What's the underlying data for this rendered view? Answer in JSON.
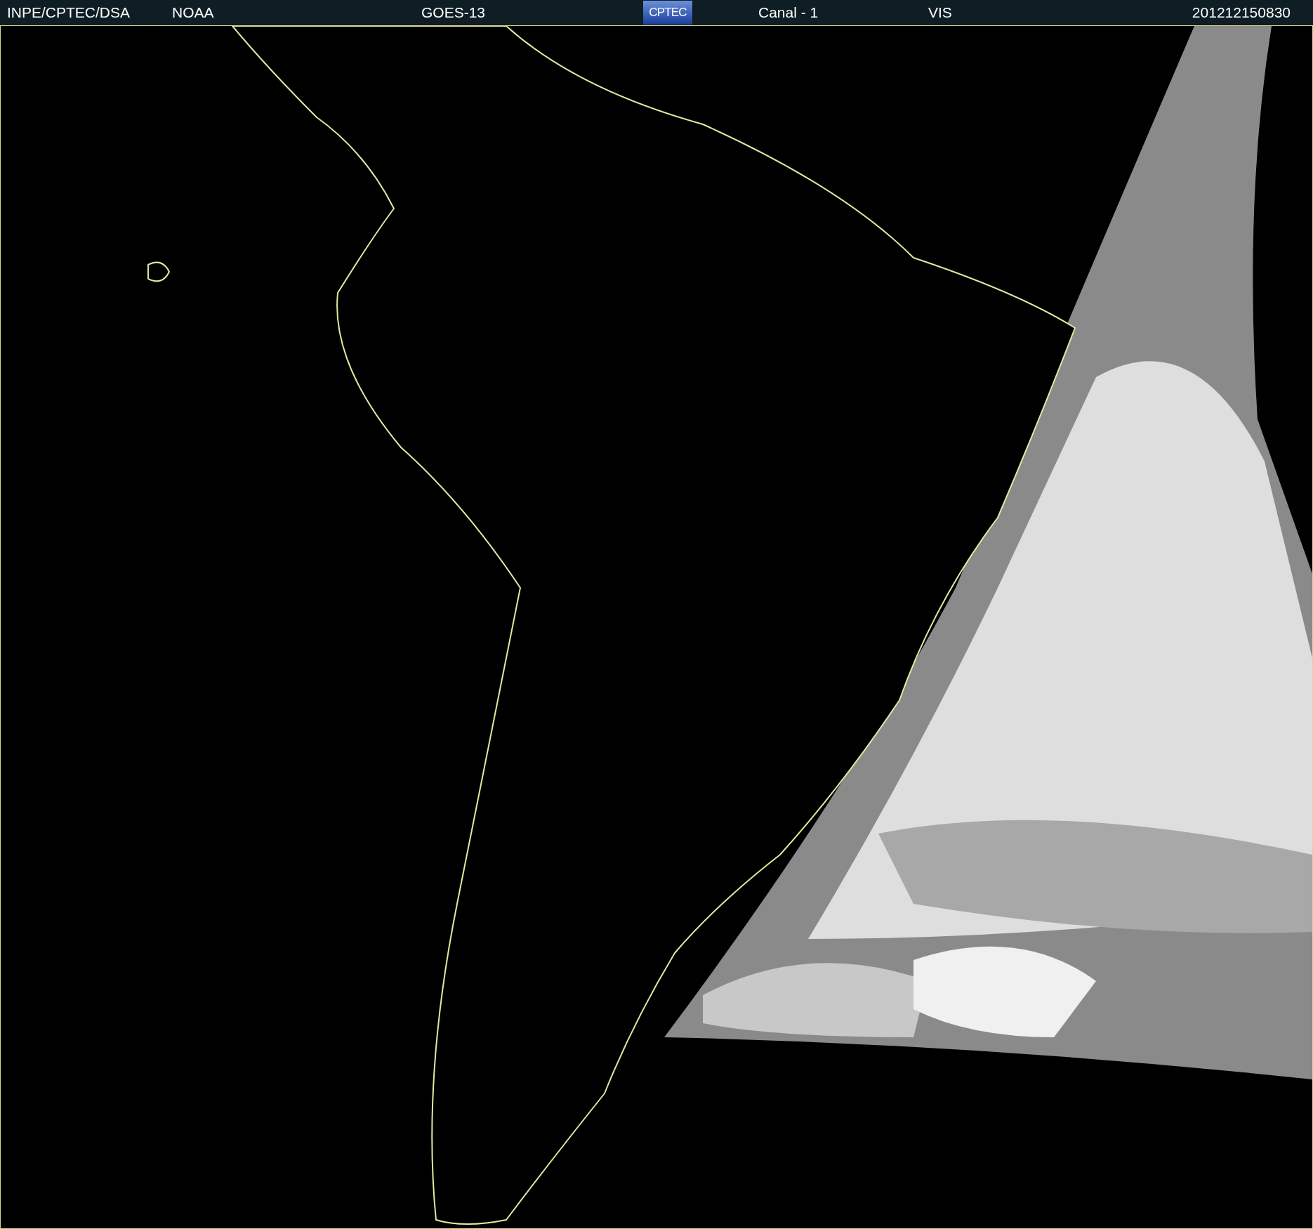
{
  "header": {
    "source": "INPE/CPTEC/DSA",
    "agency": "NOAA",
    "satellite": "GOES-13",
    "logo": "CPTEC",
    "channel": "Canal - 1",
    "band": "VIS",
    "timestamp": "201212150830"
  }
}
